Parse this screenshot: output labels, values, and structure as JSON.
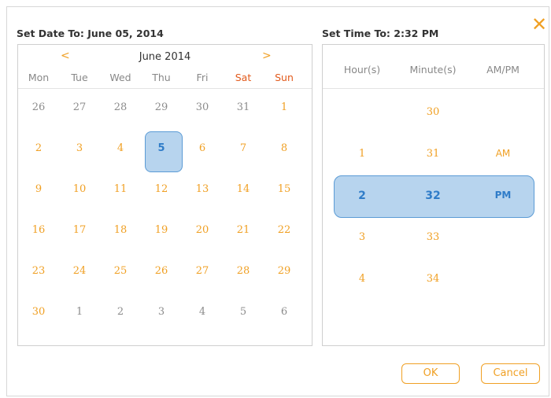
{
  "date_picker": {
    "title": "Set Date To: June 05, 2014",
    "prev_symbol": "<",
    "next_symbol": ">",
    "month_label": "June 2014",
    "weekdays": [
      "Mon",
      "Tue",
      "Wed",
      "Thu",
      "Fri",
      "Sat",
      "Sun"
    ],
    "weeks": [
      [
        "26",
        "27",
        "28",
        "29",
        "30",
        "31",
        "1"
      ],
      [
        "2",
        "3",
        "4",
        "5",
        "6",
        "7",
        "8"
      ],
      [
        "9",
        "10",
        "11",
        "12",
        "13",
        "14",
        "15"
      ],
      [
        "16",
        "17",
        "18",
        "19",
        "20",
        "21",
        "22"
      ],
      [
        "23",
        "24",
        "25",
        "26",
        "27",
        "28",
        "29"
      ],
      [
        "30",
        "1",
        "2",
        "3",
        "4",
        "5",
        "6"
      ]
    ],
    "selected_day": "5"
  },
  "time_picker": {
    "title": "Set Time To: 2:32 PM",
    "headers": [
      "Hour(s)",
      "Minute(s)",
      "AM/PM"
    ],
    "hours": [
      "",
      "1",
      "2",
      "3",
      "4"
    ],
    "minutes": [
      "30",
      "31",
      "32",
      "33",
      "34"
    ],
    "ampm": [
      "",
      "AM",
      "PM",
      "",
      ""
    ]
  },
  "buttons": {
    "ok": "OK",
    "cancel": "Cancel",
    "close_symbol": "✕"
  },
  "colors": {
    "accent": "#f0a024",
    "weekend": "#e25a1c",
    "selection": "#b7d4ee",
    "selection_text": "#2f7cc8"
  }
}
